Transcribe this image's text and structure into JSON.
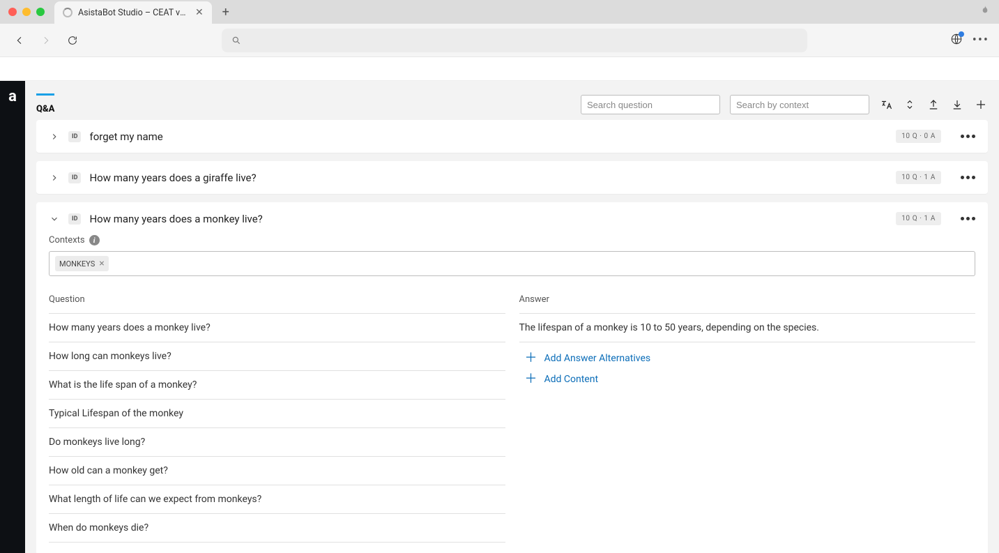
{
  "browser": {
    "tab_title": "AsistaBot Studio – CEAT vRCM"
  },
  "app": {
    "tab_label": "Q&A",
    "search_question_placeholder": "Search question",
    "search_context_placeholder": "Search by context"
  },
  "id_badge": "ID",
  "contexts_label": "Contexts",
  "question_header": "Question",
  "answer_header": "Answer",
  "add_answer_label": "Add Answer Alternatives",
  "add_content_label": "Add Content",
  "cards": [
    {
      "title": "forget my name",
      "badge": "10 Q · 0 A",
      "expanded": false
    },
    {
      "title": "How many years does a giraffe live?",
      "badge": "10 Q · 1 A",
      "expanded": false
    },
    {
      "title": "How many years does a monkey live?",
      "badge": "10 Q · 1 A",
      "expanded": true,
      "contexts": [
        "MONKEYS"
      ],
      "questions": [
        "How many years does a monkey live?",
        "How long can monkeys live?",
        "What is the life span of a monkey?",
        "Typical Lifespan of the monkey",
        "Do monkeys live long?",
        "How old can a monkey get?",
        "What length of life can we expect from monkeys?",
        "When do monkeys die?"
      ],
      "answer": "The lifespan of a monkey is 10 to 50 years, depending on the species."
    }
  ]
}
